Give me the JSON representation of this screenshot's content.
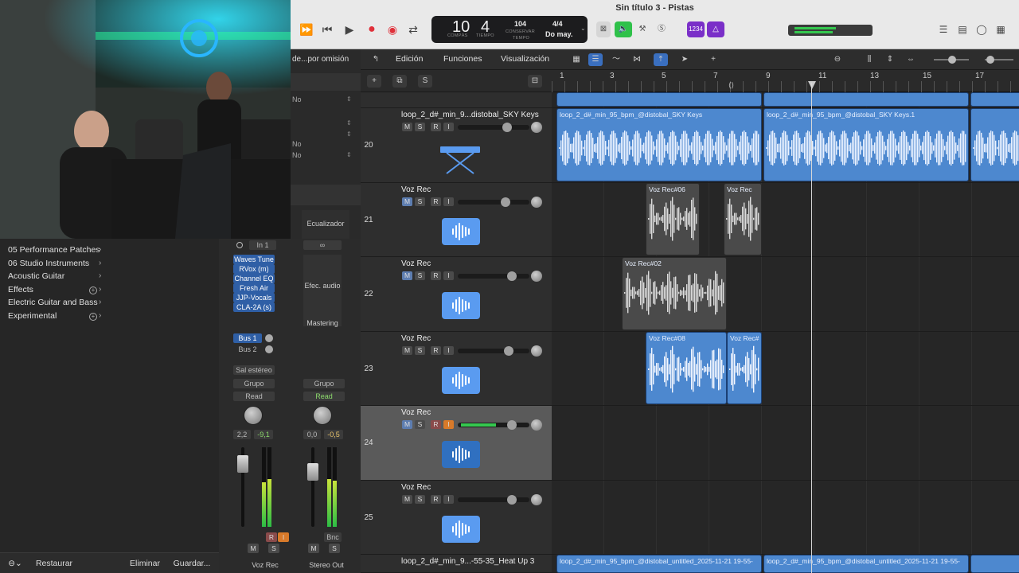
{
  "window": {
    "title": "Sin título 3 - Pistas"
  },
  "lcd": {
    "bar": "10",
    "beat": "4",
    "bar_label": "COMPÁS",
    "beat_label": "TIEMPO",
    "tempo": "104",
    "tempo_mode": "CONSERVAR",
    "tempo_label": "TEMPO",
    "time_sig": "4/4",
    "key": "Do may."
  },
  "toolbar": {
    "count_in": "1234"
  },
  "library": {
    "items": [
      {
        "label": "05 Performance Patches",
        "has_plus": false
      },
      {
        "label": "06 Studio Instruments",
        "has_plus": false
      },
      {
        "label": "Acoustic Guitar",
        "has_plus": false
      },
      {
        "label": "Effects",
        "has_plus": true
      },
      {
        "label": "Electric Guitar and Bass",
        "has_plus": false
      },
      {
        "label": "Experimental",
        "has_plus": true
      }
    ],
    "restore": "Restaurar",
    "delete": "Eliminar",
    "save": "Guardar..."
  },
  "inspector": {
    "preset_label": "de...por omisión",
    "no1": "No",
    "no2": "No",
    "no3": "No"
  },
  "strip1": {
    "input": "In 1",
    "plugins": [
      "Waves Tune",
      "RVox (m)",
      "Channel EQ",
      "Fresh Air",
      "JJP-Vocals",
      "CLA-2A (s)"
    ],
    "sends": [
      "Bus 1",
      "Bus 2"
    ],
    "output": "Sal estéreo",
    "group": "Grupo",
    "automation": "Read",
    "vol": "2,2",
    "peak": "-9,1",
    "name": "Voz Rec",
    "m": "M",
    "s": "S",
    "r": "R",
    "i": "I"
  },
  "strip2": {
    "eq": "Ecualizador",
    "audio_fx": "Efec. audio",
    "mastering": "Mastering",
    "group": "Grupo",
    "automation": "Read",
    "vol": "0,0",
    "peak": "-0,5",
    "bnc": "Bnc",
    "name": "Stereo Out",
    "m": "M",
    "s": "S"
  },
  "tracks_menu": {
    "edit": "Edición",
    "functions": "Funciones",
    "view": "Visualización",
    "s": "S"
  },
  "ruler": {
    "bars": [
      "1",
      "3",
      "5",
      "7",
      "9",
      "11",
      "13",
      "15",
      "17"
    ]
  },
  "tracks": [
    {
      "num": "20",
      "name": "loop_2_d#_min_9...distobal_SKY Keys"
    },
    {
      "num": "21",
      "name": "Voz Rec"
    },
    {
      "num": "22",
      "name": "Voz Rec"
    },
    {
      "num": "23",
      "name": "Voz Rec"
    },
    {
      "num": "24",
      "name": "Voz Rec"
    },
    {
      "num": "25",
      "name": "Voz Rec"
    },
    {
      "num": "",
      "name": "loop_2_d#_min_9...-55-35_Heat Up 3"
    }
  ],
  "regions": {
    "keys1": "loop_2_d#_min_95_bpm_@distobal_SKY Keys",
    "keys2": "loop_2_d#_min_95_bpm_@distobal_SKY Keys.1",
    "vr06": "Voz Rec#06",
    "vr_a": "Voz Rec",
    "vr02": "Voz Rec#02",
    "vr08": "Voz Rec#08",
    "vr_b": "Voz Rec#",
    "heat1": "loop_2_d#_min_95_bpm_@distobal_untitled_2025-11-21 19-55-",
    "heat2": "loop_2_d#_min_95_bpm_@distobal_untitled_2025-11-21 19-55-"
  },
  "track_buttons": {
    "m": "M",
    "s": "S",
    "r": "R",
    "i": "I"
  },
  "colors": {
    "accent_blue": "#4d88cf",
    "record_red": "#e0303a",
    "green": "#2fc14a",
    "purple": "#7a2fc8"
  }
}
